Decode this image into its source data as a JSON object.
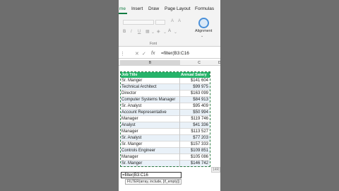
{
  "ribbon": {
    "tabs": [
      "me",
      "Insert",
      "Draw",
      "Page Layout",
      "Formulas"
    ],
    "active_tab": "me",
    "font_group_label": "Font",
    "alignment_label": "Alignment",
    "accent": "#107c41"
  },
  "formula_bar": {
    "cancel_icon": "close-icon",
    "enter_icon": "check-icon",
    "fx_label": "fx",
    "text": "=filter(B3:C16"
  },
  "columns": {
    "b": "B",
    "c": "C",
    "d": "D"
  },
  "table": {
    "header_color": "#27b36a",
    "headers": [
      "Job Title",
      "Annual Salary"
    ],
    "rows": [
      [
        "Sr. Manger",
        "$141 604"
      ],
      [
        "Technical Architect",
        "$99 975"
      ],
      [
        "Director",
        "$163 099"
      ],
      [
        "Computer Systems Manager",
        "$84 913"
      ],
      [
        "Sr. Analyst",
        "$95 409"
      ],
      [
        "Account Representative",
        "$50 994"
      ],
      [
        "Manager",
        "$119 746"
      ],
      [
        "Analyst",
        "$41 336"
      ],
      [
        "Manager",
        "$113 527"
      ],
      [
        "Sr. Analyst",
        "$77 203"
      ],
      [
        "Sr. Manger",
        "$157 333"
      ],
      [
        "Controls Engineer",
        "$109 851"
      ],
      [
        "Manager",
        "$105 086"
      ],
      [
        "Sr. Manger",
        "$146 742"
      ]
    ]
  },
  "selection_badge": "14R",
  "edit_cell": "=filter(B3:C16",
  "tooltip": "FILTER(array, include, [if_empty])"
}
